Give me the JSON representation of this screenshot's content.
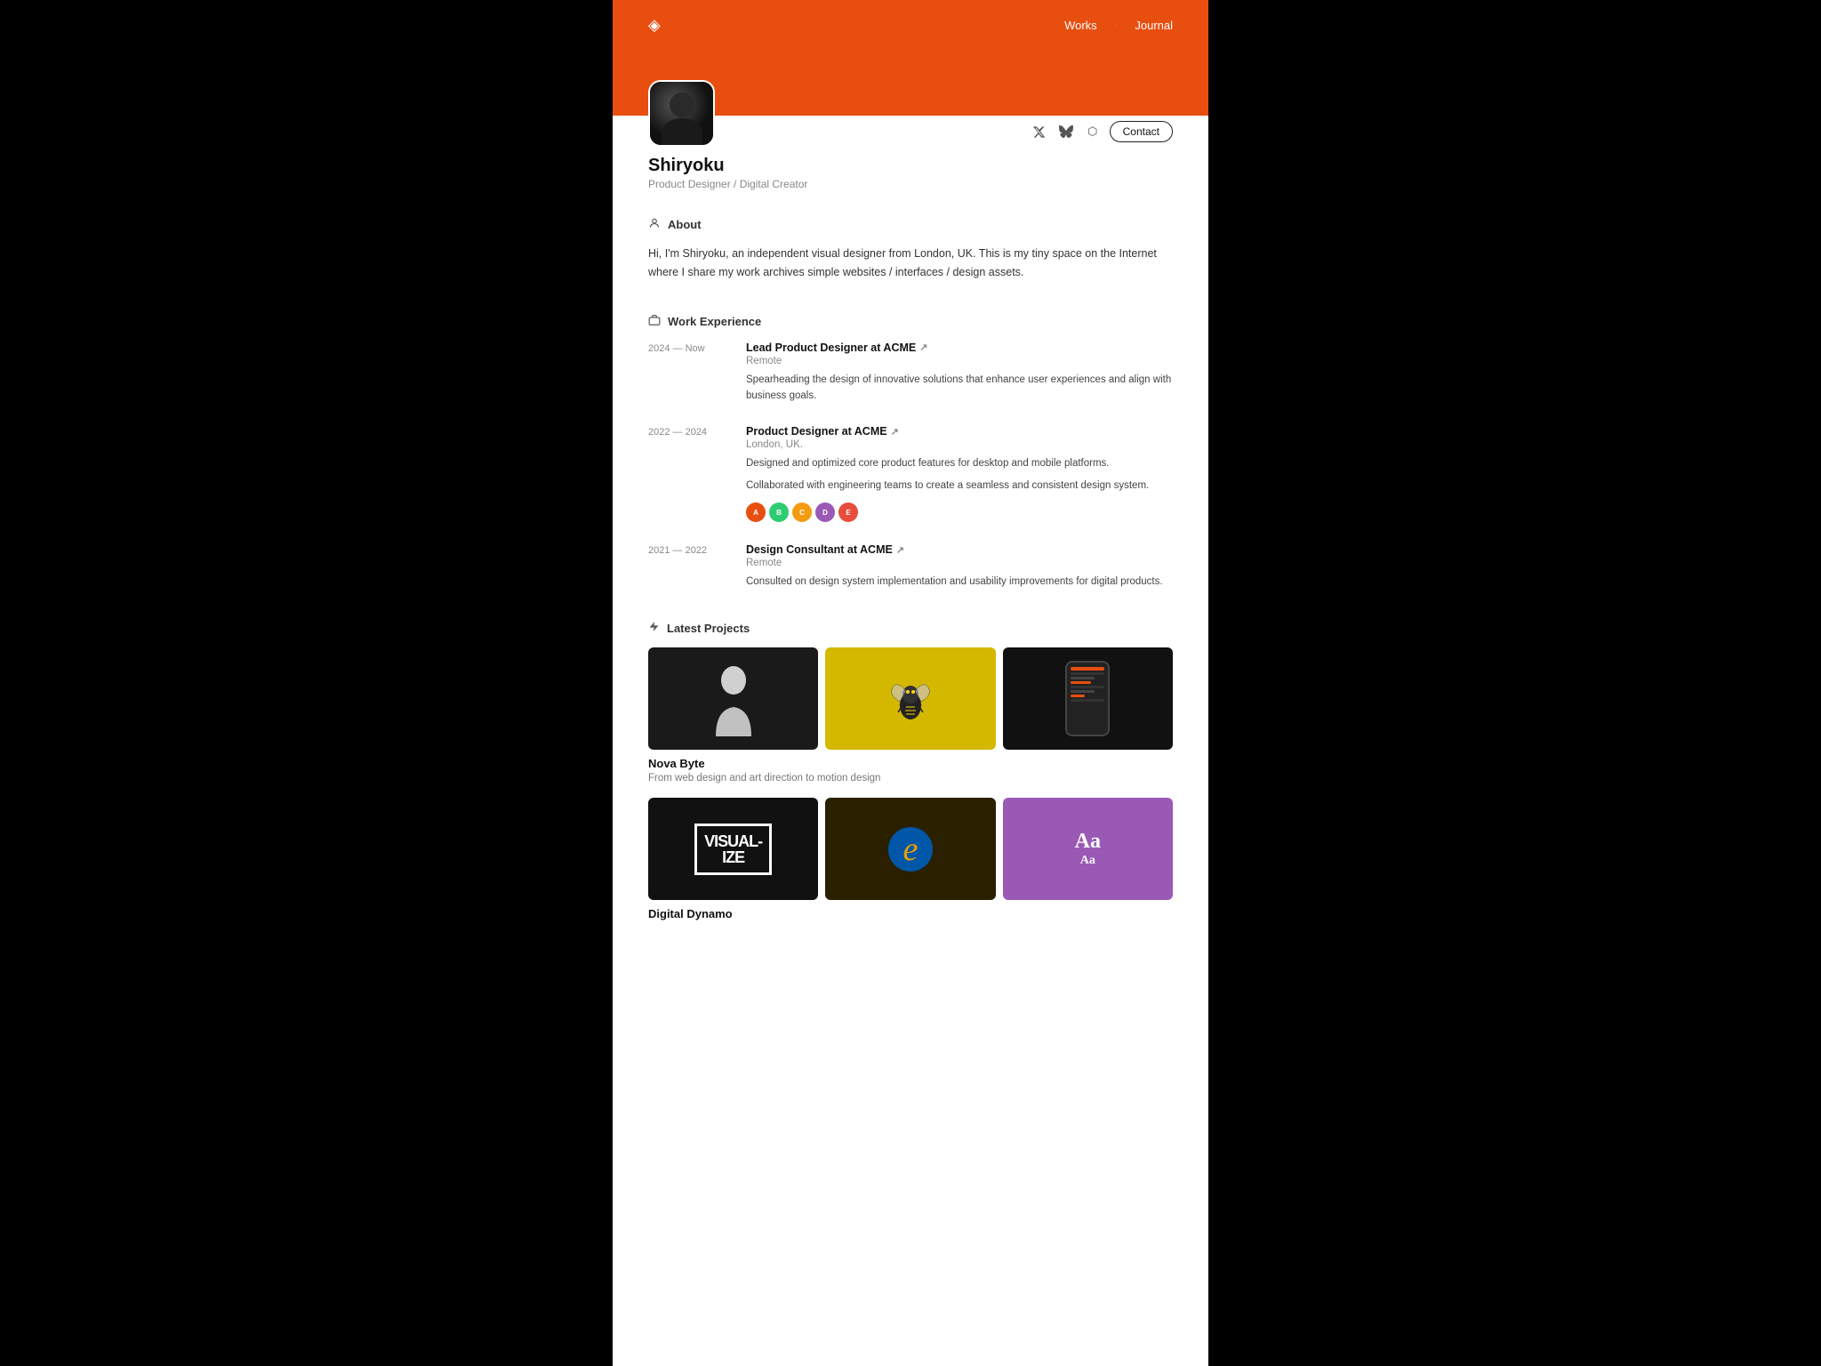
{
  "header": {
    "logo_icon": "◈",
    "nav": [
      {
        "label": "Works",
        "href": "#"
      },
      {
        "separator": "·"
      },
      {
        "label": "Journal",
        "href": "#"
      }
    ]
  },
  "profile": {
    "name": "Shiryoku",
    "title": "Product Designer / Digital Creator",
    "social": [
      {
        "icon": "𝕏",
        "name": "x-icon"
      },
      {
        "icon": "🦋",
        "name": "bluesky-icon"
      },
      {
        "icon": "⬡",
        "name": "other-icon"
      }
    ],
    "contact_label": "Contact"
  },
  "about": {
    "section_title": "About",
    "text": "Hi, I'm Shiryoku, an independent visual designer from London, UK. This is my tiny space on the Internet where I share my work archives simple websites / interfaces / design assets."
  },
  "work_experience": {
    "section_title": "Work Experience",
    "items": [
      {
        "date": "2024 — Now",
        "title": "Lead Product Designer at ACME",
        "location": "Remote",
        "descriptions": [
          "Spearheading the design of innovative solutions that enhance user experiences and align with business goals."
        ],
        "avatars": []
      },
      {
        "date": "2022 — 2024",
        "title": "Product Designer at ACME",
        "location": "London, UK.",
        "descriptions": [
          "Designed and optimized core product features for desktop and mobile platforms.",
          "Collaborated with engineering teams to create a seamless and consistent design system."
        ],
        "avatars": [
          {
            "color": "#E84E0F",
            "label": "A"
          },
          {
            "color": "#2ECC71",
            "label": "B"
          },
          {
            "color": "#F39C12",
            "label": "C"
          },
          {
            "color": "#9B59B6",
            "label": "D"
          },
          {
            "color": "#E74C3C",
            "label": "E"
          }
        ]
      },
      {
        "date": "2021 — 2022",
        "title": "Design Consultant at ACME",
        "location": "Remote",
        "descriptions": [
          "Consulted on design system implementation and usability improvements for digital products."
        ],
        "avatars": []
      }
    ]
  },
  "latest_projects": {
    "section_title": "Latest Projects",
    "groups": [
      {
        "label": "Nova Byte",
        "sub": "From web design and art direction to motion design",
        "thumbs": [
          "silhouette",
          "bee",
          "phone"
        ]
      },
      {
        "label": "Digital Dynamo",
        "sub": "",
        "thumbs": [
          "visualize",
          "ie",
          "typography"
        ]
      }
    ]
  }
}
